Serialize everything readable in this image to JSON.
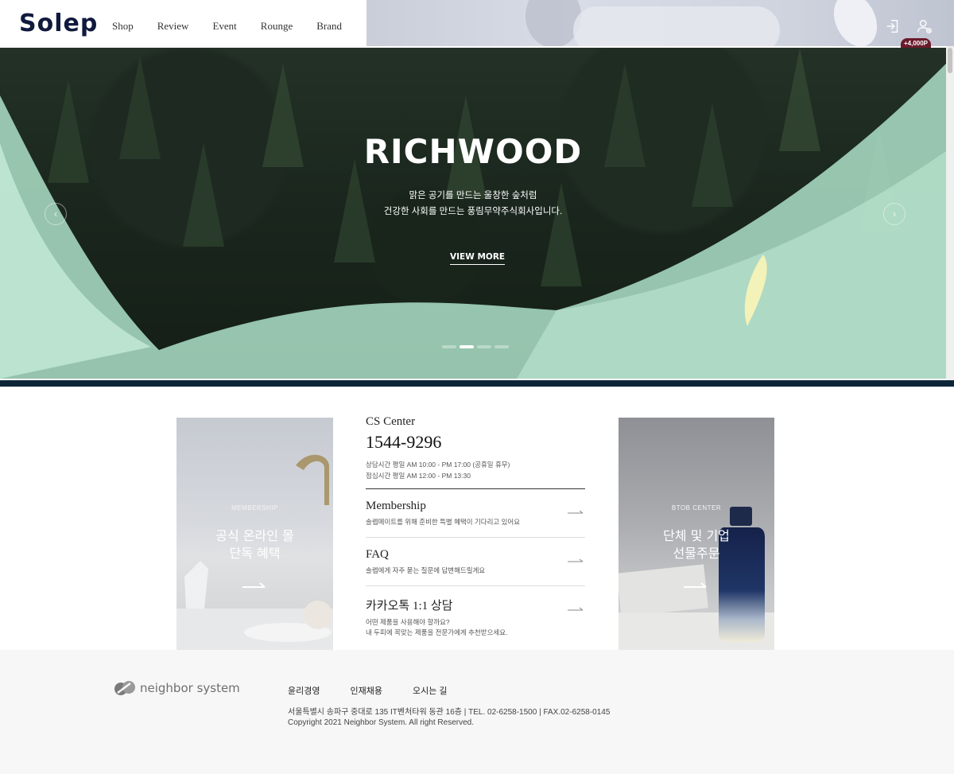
{
  "header": {
    "logo": "Solep",
    "nav": [
      "Shop",
      "Review",
      "Event",
      "Rounge",
      "Brand"
    ],
    "badge": "+4,000P"
  },
  "hero": {
    "title": "RICHWOOD",
    "subtitle_line1": "맑은 공기를 만드는 울창한 숲처럼",
    "subtitle_line2": "건강한 사회를 만드는 풍림무약주식회사입니다.",
    "button": "VIEW MORE",
    "prev_arrow": "‹",
    "next_arrow": "›",
    "slide_count": 4,
    "active_slide": 2
  },
  "membership_card": {
    "kicker": "MEMBERSHIP",
    "title_line1": "공식 온라인 몰",
    "title_line2": "단독 혜택"
  },
  "cs": {
    "title": "CS Center",
    "phone": "1544-9296",
    "hours_line1": "상담시간 평일 AM 10:00 - PM 17:00 (공휴일 휴무)",
    "hours_line2": "점심시간 평일 AM 12:00 - PM 13:30",
    "items": [
      {
        "title": "Membership",
        "desc1": "솔렙메이트를 위해 준비한 특별 혜택이 기다리고 있어요",
        "desc2": ""
      },
      {
        "title": "FAQ",
        "desc1": "솔렙에게 자주 묻는 질문에 답변해드릴게요",
        "desc2": ""
      },
      {
        "title": "카카오톡 1:1 상담",
        "desc1": "어떤 제품을 사용해야 할까요?",
        "desc2": "내 두피에 꼭맞는 제품을 전문가에게 추천받으세요."
      }
    ]
  },
  "btob_card": {
    "kicker": "BTOB CENTER",
    "title_line1": "단체 및 기업",
    "title_line2": "선물주문"
  },
  "footer": {
    "logo": "neighbor system",
    "links": [
      "윤리경영",
      "인재채용",
      "오시는 길"
    ],
    "address": "서울특별시 송파구 중대로 135 IT벤처타워 동관 16층  |  TEL. 02-6258-1500  |  FAX.02-6258-0145",
    "copyright": "Copyright 2021 Neighbor System. All right Reserved."
  }
}
